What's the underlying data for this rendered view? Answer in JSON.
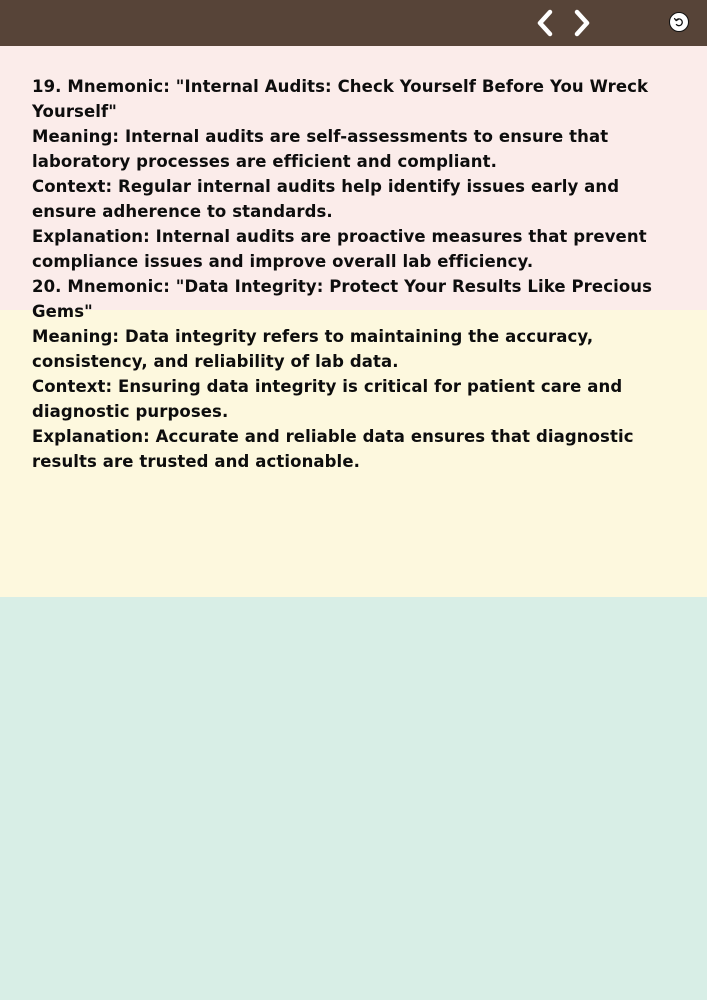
{
  "toolbar": {
    "prev_icon": "chevron-left-icon",
    "next_icon": "chevron-right-icon",
    "undo_icon": "undo-icon"
  },
  "colors": {
    "topbar": "#574438",
    "band_pink": "#fbecea",
    "band_yellow": "#fdf8de",
    "band_mint": "#d8eee6",
    "text": "#0d0d0d"
  },
  "content": {
    "lines": [
      "19. Mnemonic: \"Internal Audits: Check Yourself Before You Wreck Yourself\"",
      "Meaning: Internal audits are self-assessments to ensure that laboratory processes are efficient and compliant.",
      "Context: Regular internal audits help identify issues early and ensure adherence to standards.",
      "Explanation: Internal audits are proactive measures that prevent compliance issues and improve overall lab efficiency.",
      "20. Mnemonic: \"Data Integrity: Protect Your Results Like Precious Gems\"",
      "Meaning: Data integrity refers to maintaining the accuracy, consistency, and reliability of lab data.",
      "Context: Ensuring data integrity is critical for patient care and diagnostic purposes.",
      "Explanation: Accurate and reliable data ensures that diagnostic results are trusted and actionable."
    ]
  }
}
